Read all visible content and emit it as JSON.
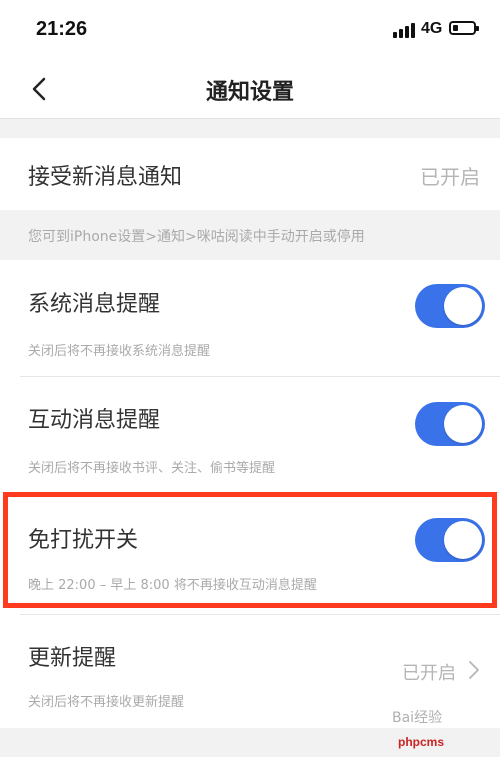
{
  "status_bar": {
    "time": "21:26",
    "network": "4G"
  },
  "nav": {
    "title": "通知设置"
  },
  "receive_new": {
    "label": "接受新消息通知",
    "value": "已开启"
  },
  "tip": "您可到iPhone设置>通知>咪咕阅读中手动开启或停用",
  "items": [
    {
      "label": "系统消息提醒",
      "sub": "关闭后将不再接收系统消息提醒",
      "enabled": true
    },
    {
      "label": "互动消息提醒",
      "sub": "关闭后将不再接收书评、关注、偷书等提醒",
      "enabled": true
    },
    {
      "label": "免打扰开关",
      "sub": "晚上 22:00 – 早上 8:00 将不再接收互动消息提醒",
      "enabled": true
    }
  ],
  "update": {
    "label": "更新提醒",
    "sub": "关闭后将不再接收更新提醒",
    "value": "已开启"
  },
  "watermark": {
    "text": "Bai经验",
    "site": "phpcms"
  },
  "colors": {
    "toggle_on": "#3a72ea",
    "highlight": "#ff3b1f",
    "page_bg": "#f2f2f2"
  }
}
